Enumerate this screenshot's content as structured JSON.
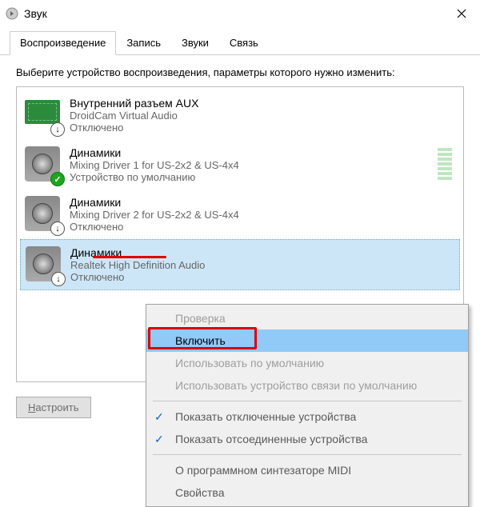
{
  "window": {
    "title": "Звук"
  },
  "tabs": {
    "items": [
      {
        "label": "Воспроизведение"
      },
      {
        "label": "Запись"
      },
      {
        "label": "Звуки"
      },
      {
        "label": "Связь"
      }
    ],
    "active": 0
  },
  "instruction": "Выберите устройство воспроизведения, параметры которого нужно изменить:",
  "devices": [
    {
      "name": "Внутренний разъем  AUX",
      "desc": "DroidCam Virtual Audio",
      "status": "Отключено",
      "icon": "aux",
      "badge": "down"
    },
    {
      "name": "Динамики",
      "desc": "Mixing Driver 1 for US-2x2 & US-4x4",
      "status": "Устройство по умолчанию",
      "icon": "speaker",
      "badge": "check",
      "meter": true
    },
    {
      "name": "Динамики",
      "desc": "Mixing Driver 2 for US-2x2 & US-4x4",
      "status": "Отключено",
      "icon": "speaker",
      "badge": "down"
    },
    {
      "name": "Динамики",
      "desc": "Realtek High Definition Audio",
      "status": "Отключено",
      "icon": "speaker",
      "badge": "down",
      "selected": true
    }
  ],
  "buttons": {
    "configure": "Настроить"
  },
  "context_menu": {
    "items": [
      {
        "label": "Проверка",
        "state": "disabled"
      },
      {
        "label": "Включить",
        "state": "highlight"
      },
      {
        "label": "Использовать по умолчанию",
        "state": "disabled"
      },
      {
        "label": "Использовать устройство связи по умолчанию",
        "state": "disabled"
      },
      {
        "sep": true
      },
      {
        "label": "Показать отключенные устройства",
        "checked": true
      },
      {
        "label": "Показать отсоединенные устройства",
        "checked": true
      },
      {
        "sep": true
      },
      {
        "label": "О программном синтезаторе MIDI"
      },
      {
        "label": "Свойства"
      }
    ]
  }
}
